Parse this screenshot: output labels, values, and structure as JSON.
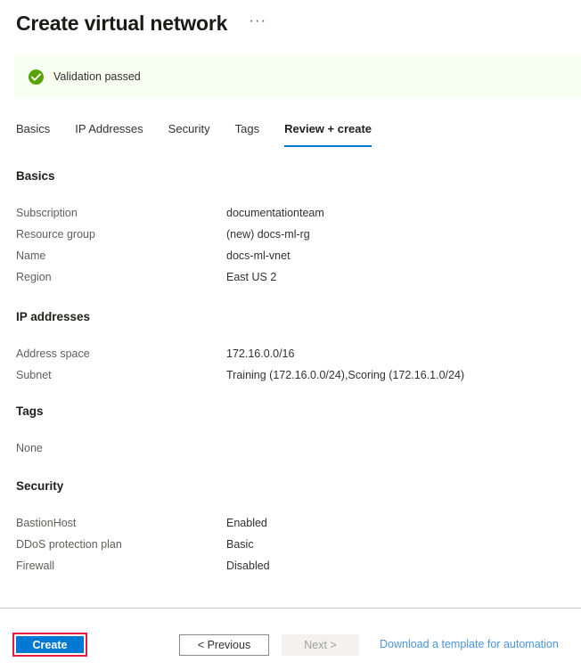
{
  "header": {
    "title": "Create virtual network",
    "more_menu": "···"
  },
  "validation": {
    "icon": "check-circle-icon",
    "message": "Validation passed",
    "background_color": "#f6fff0",
    "icon_color": "#57a300"
  },
  "tabs": [
    {
      "label": "Basics",
      "active": false
    },
    {
      "label": "IP Addresses",
      "active": false
    },
    {
      "label": "Security",
      "active": false
    },
    {
      "label": "Tags",
      "active": false
    },
    {
      "label": "Review + create",
      "active": true
    }
  ],
  "active_tab_accent": "#0078d4",
  "sections": {
    "basics": {
      "title": "Basics",
      "rows": [
        {
          "key": "Subscription",
          "value": "documentationteam"
        },
        {
          "key": "Resource group",
          "value": "(new) docs-ml-rg"
        },
        {
          "key": "Name",
          "value": "docs-ml-vnet"
        },
        {
          "key": "Region",
          "value": "East US 2"
        }
      ]
    },
    "ip_addresses": {
      "title": "IP addresses",
      "rows": [
        {
          "key": "Address space",
          "value": "172.16.0.0/16"
        },
        {
          "key": "Subnet",
          "value": "Training (172.16.0.0/24),Scoring (172.16.1.0/24)"
        }
      ]
    },
    "tags": {
      "title": "Tags",
      "empty_text": "None"
    },
    "security": {
      "title": "Security",
      "rows": [
        {
          "key": "BastionHost",
          "value": "Enabled"
        },
        {
          "key": "DDoS protection plan",
          "value": "Basic"
        },
        {
          "key": "Firewall",
          "value": "Disabled"
        }
      ]
    }
  },
  "footer": {
    "create_label": "Create",
    "previous_label": "< Previous",
    "next_label": "Next >",
    "download_label": "Download a template for automation",
    "create_button_color": "#0078d4",
    "highlight_color": "#ec1944",
    "link_color": "#4a95db"
  }
}
